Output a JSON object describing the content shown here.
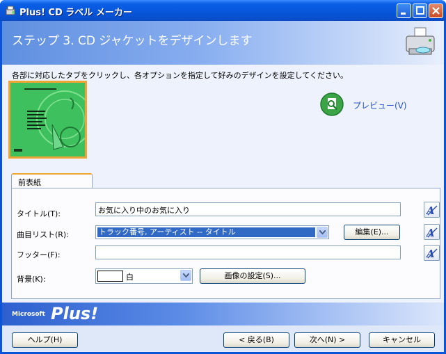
{
  "window": {
    "title": "Plus! CD ラベル メーカー"
  },
  "header": {
    "title": "ステップ 3. CD ジャケットをデザインします"
  },
  "instruction": "各部に対応したタブをクリックし、各オプションを指定して好みのデザインを設定してください。",
  "preview": {
    "link_label": "プレビュー(V)"
  },
  "tab": {
    "label": "前表紙"
  },
  "form": {
    "title_label": "タイトル(T):",
    "title_value": "お気に入り中のお気に入り",
    "tracklist_label": "曲目リスト(R):",
    "tracklist_value": "トラック番号, アーティスト -- タイトル",
    "edit_button": "編集(E)...",
    "footer_label": "フッター(F):",
    "footer_value": "",
    "background_label": "背景(K):",
    "background_value": "白",
    "image_button": "画像の設定(S)..."
  },
  "brand": {
    "ms": "Microsoft",
    "plus": "Plus!"
  },
  "buttons": {
    "help": "ヘルプ(H)",
    "back": "< 戻る(B)",
    "next": "次へ(N) >",
    "cancel": "キャンセル"
  },
  "colors": {
    "titlebar": "#0a54d8",
    "accent_orange": "#f1a531",
    "link_blue": "#2a55c8",
    "selection": "#316ac5"
  }
}
